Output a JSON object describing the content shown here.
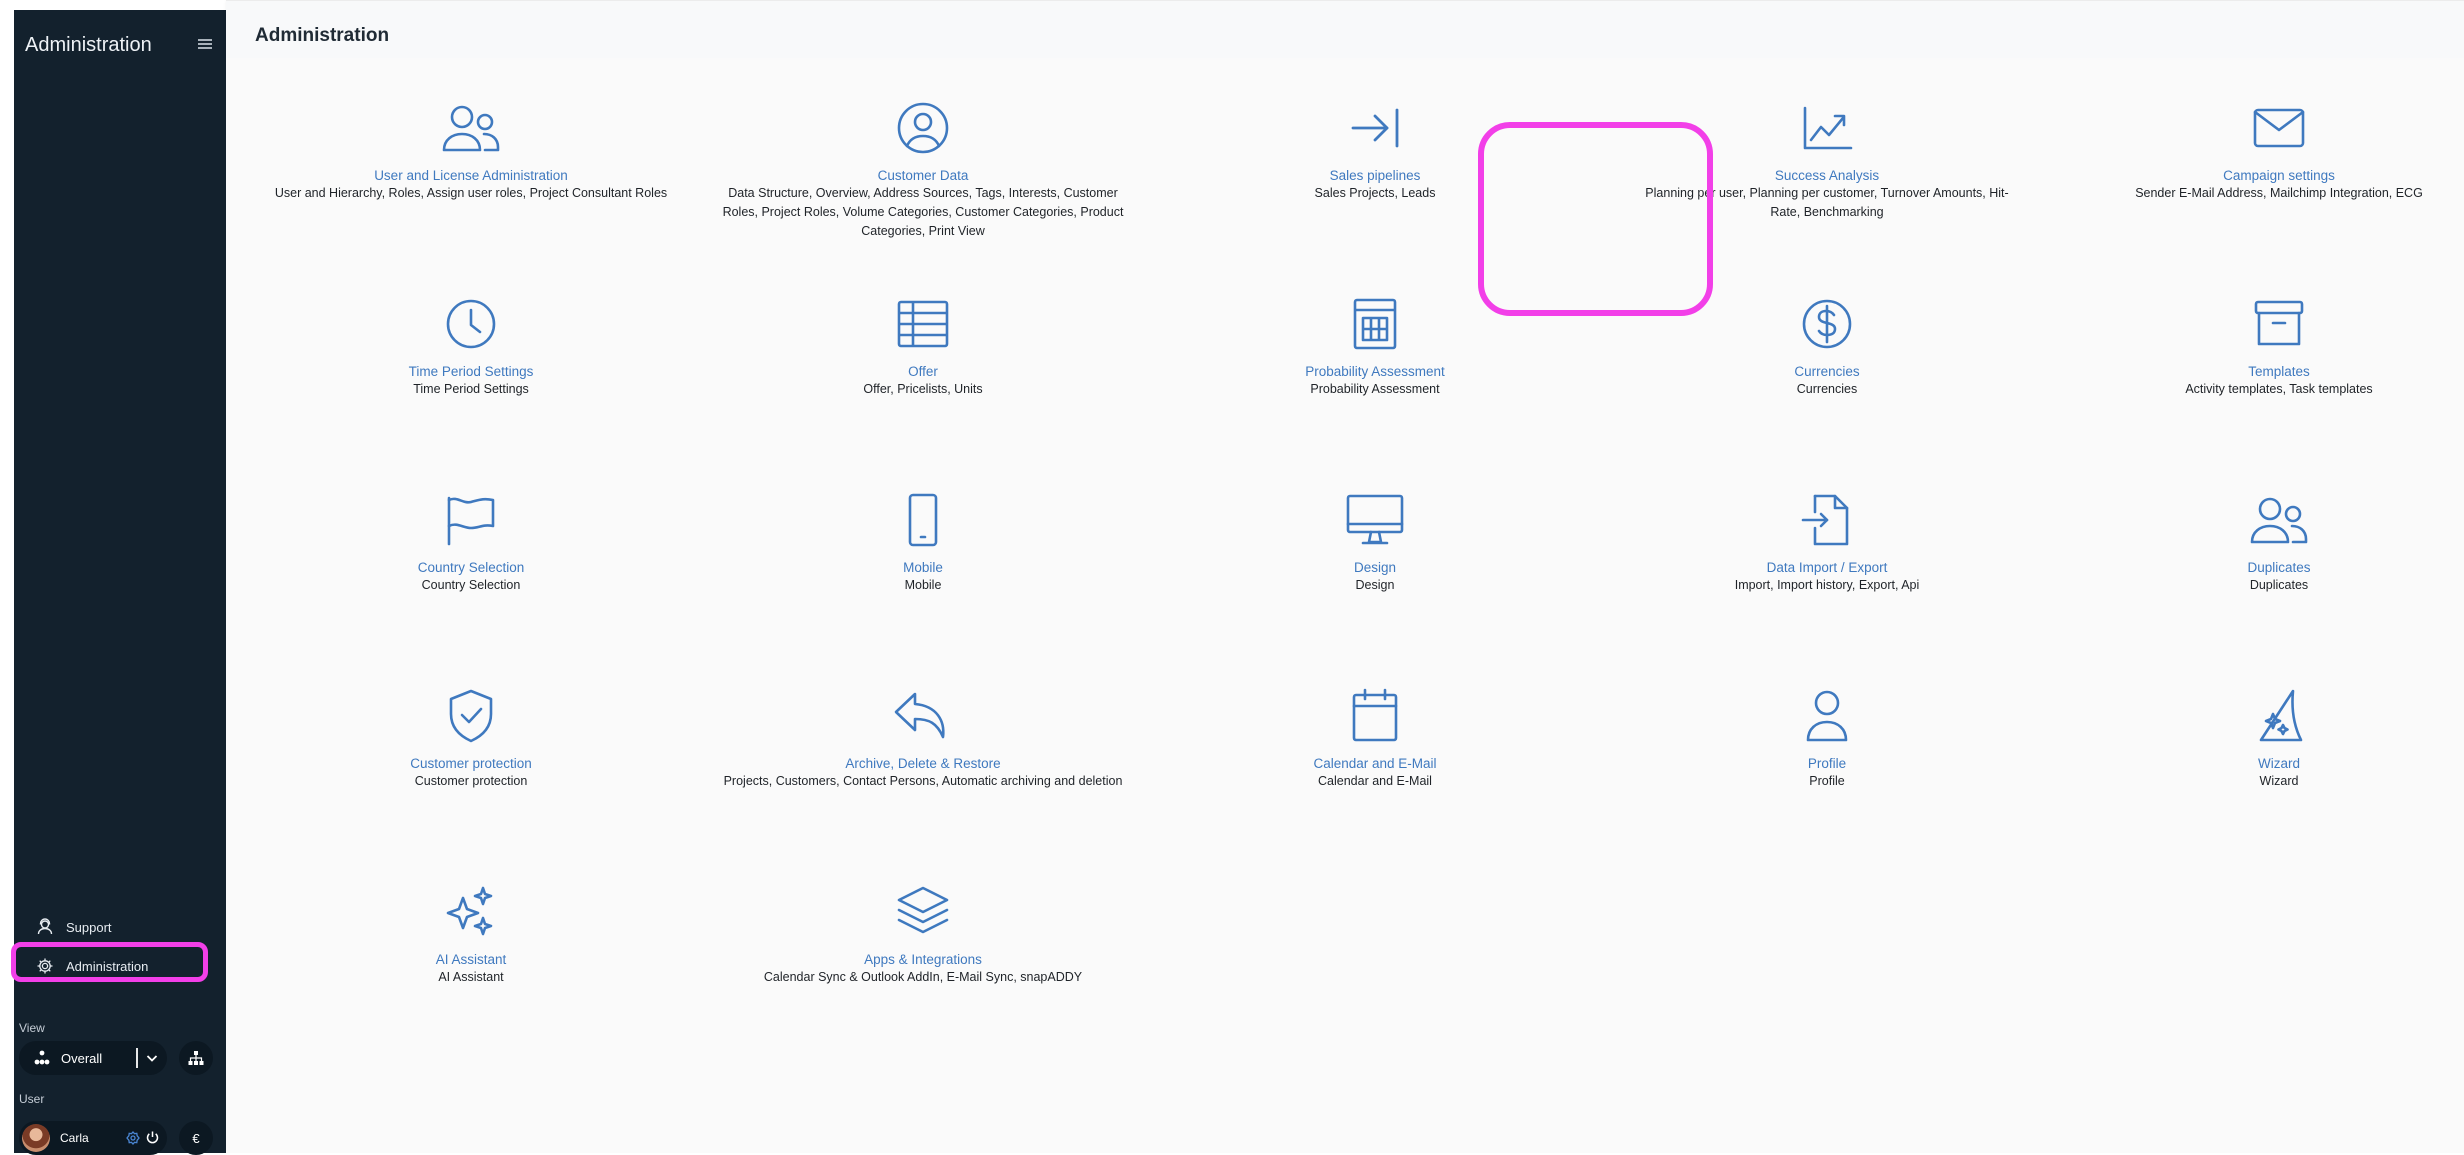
{
  "sidebar": {
    "title": "Administration",
    "support_label": "Support",
    "administration_label": "Administration",
    "view_label": "View",
    "view_value": "Overall",
    "user_label": "User",
    "user_name": "Carla",
    "currency_symbol": "€"
  },
  "header": {
    "title": "Administration"
  },
  "colors": {
    "accent": "#3f79bf",
    "sidebar_bg": "#13212d",
    "highlight": "#f23fe8"
  },
  "tiles": [
    {
      "icon": "users-icon",
      "title": "User and License Administration",
      "desc": "User and Hierarchy, Roles, Assign user roles, Project Consultant Roles"
    },
    {
      "icon": "user-circle-icon",
      "title": "Customer Data",
      "desc": "Data Structure, Overview, Address Sources, Tags, Interests, Customer Roles, Project Roles, Volume Categories, Customer Categories, Product Categories, Print View"
    },
    {
      "icon": "arrow-to-line-icon",
      "title": "Sales pipelines",
      "desc": "Sales Projects, Leads"
    },
    {
      "icon": "chart-trend-icon",
      "title": "Success Analysis",
      "desc": "Planning per user, Planning per customer, Turnover Amounts, Hit-Rate, Benchmarking"
    },
    {
      "icon": "envelope-icon",
      "title": "Campaign settings",
      "desc": "Sender E-Mail Address, Mailchimp Integration, ECG"
    },
    {
      "icon": "clock-icon",
      "title": "Time Period Settings",
      "desc": "Time Period Settings"
    },
    {
      "icon": "table-icon",
      "title": "Offer",
      "desc": "Offer, Pricelists, Units"
    },
    {
      "icon": "calculator-icon",
      "title": "Probability Assessment",
      "desc": "Probability Assessment"
    },
    {
      "icon": "dollar-coin-icon",
      "title": "Currencies",
      "desc": "Currencies"
    },
    {
      "icon": "archive-box-icon",
      "title": "Templates",
      "desc": "Activity templates, Task templates"
    },
    {
      "icon": "flag-icon",
      "title": "Country Selection",
      "desc": "Country Selection"
    },
    {
      "icon": "phone-icon",
      "title": "Mobile",
      "desc": "Mobile"
    },
    {
      "icon": "monitor-icon",
      "title": "Design",
      "desc": "Design"
    },
    {
      "icon": "file-import-icon",
      "title": "Data Import / Export",
      "desc": "Import, Import history, Export, Api"
    },
    {
      "icon": "users-duplicate-icon",
      "title": "Duplicates",
      "desc": "Duplicates"
    },
    {
      "icon": "shield-check-icon",
      "title": "Customer protection",
      "desc": "Customer protection"
    },
    {
      "icon": "reply-arrow-icon",
      "title": "Archive, Delete & Restore",
      "desc": "Projects, Customers, Contact Persons, Automatic archiving and deletion"
    },
    {
      "icon": "calendar-icon",
      "title": "Calendar and E-Mail",
      "desc": "Calendar and E-Mail"
    },
    {
      "icon": "user-icon",
      "title": "Profile",
      "desc": "Profile"
    },
    {
      "icon": "wizard-hat-icon",
      "title": "Wizard",
      "desc": "Wizard"
    },
    {
      "icon": "sparkles-icon",
      "title": "AI Assistant",
      "desc": "AI Assistant"
    },
    {
      "icon": "layers-icon",
      "title": "Apps & Integrations",
      "desc": "Calendar Sync & Outlook AddIn, E-Mail Sync, snapADDY"
    }
  ]
}
